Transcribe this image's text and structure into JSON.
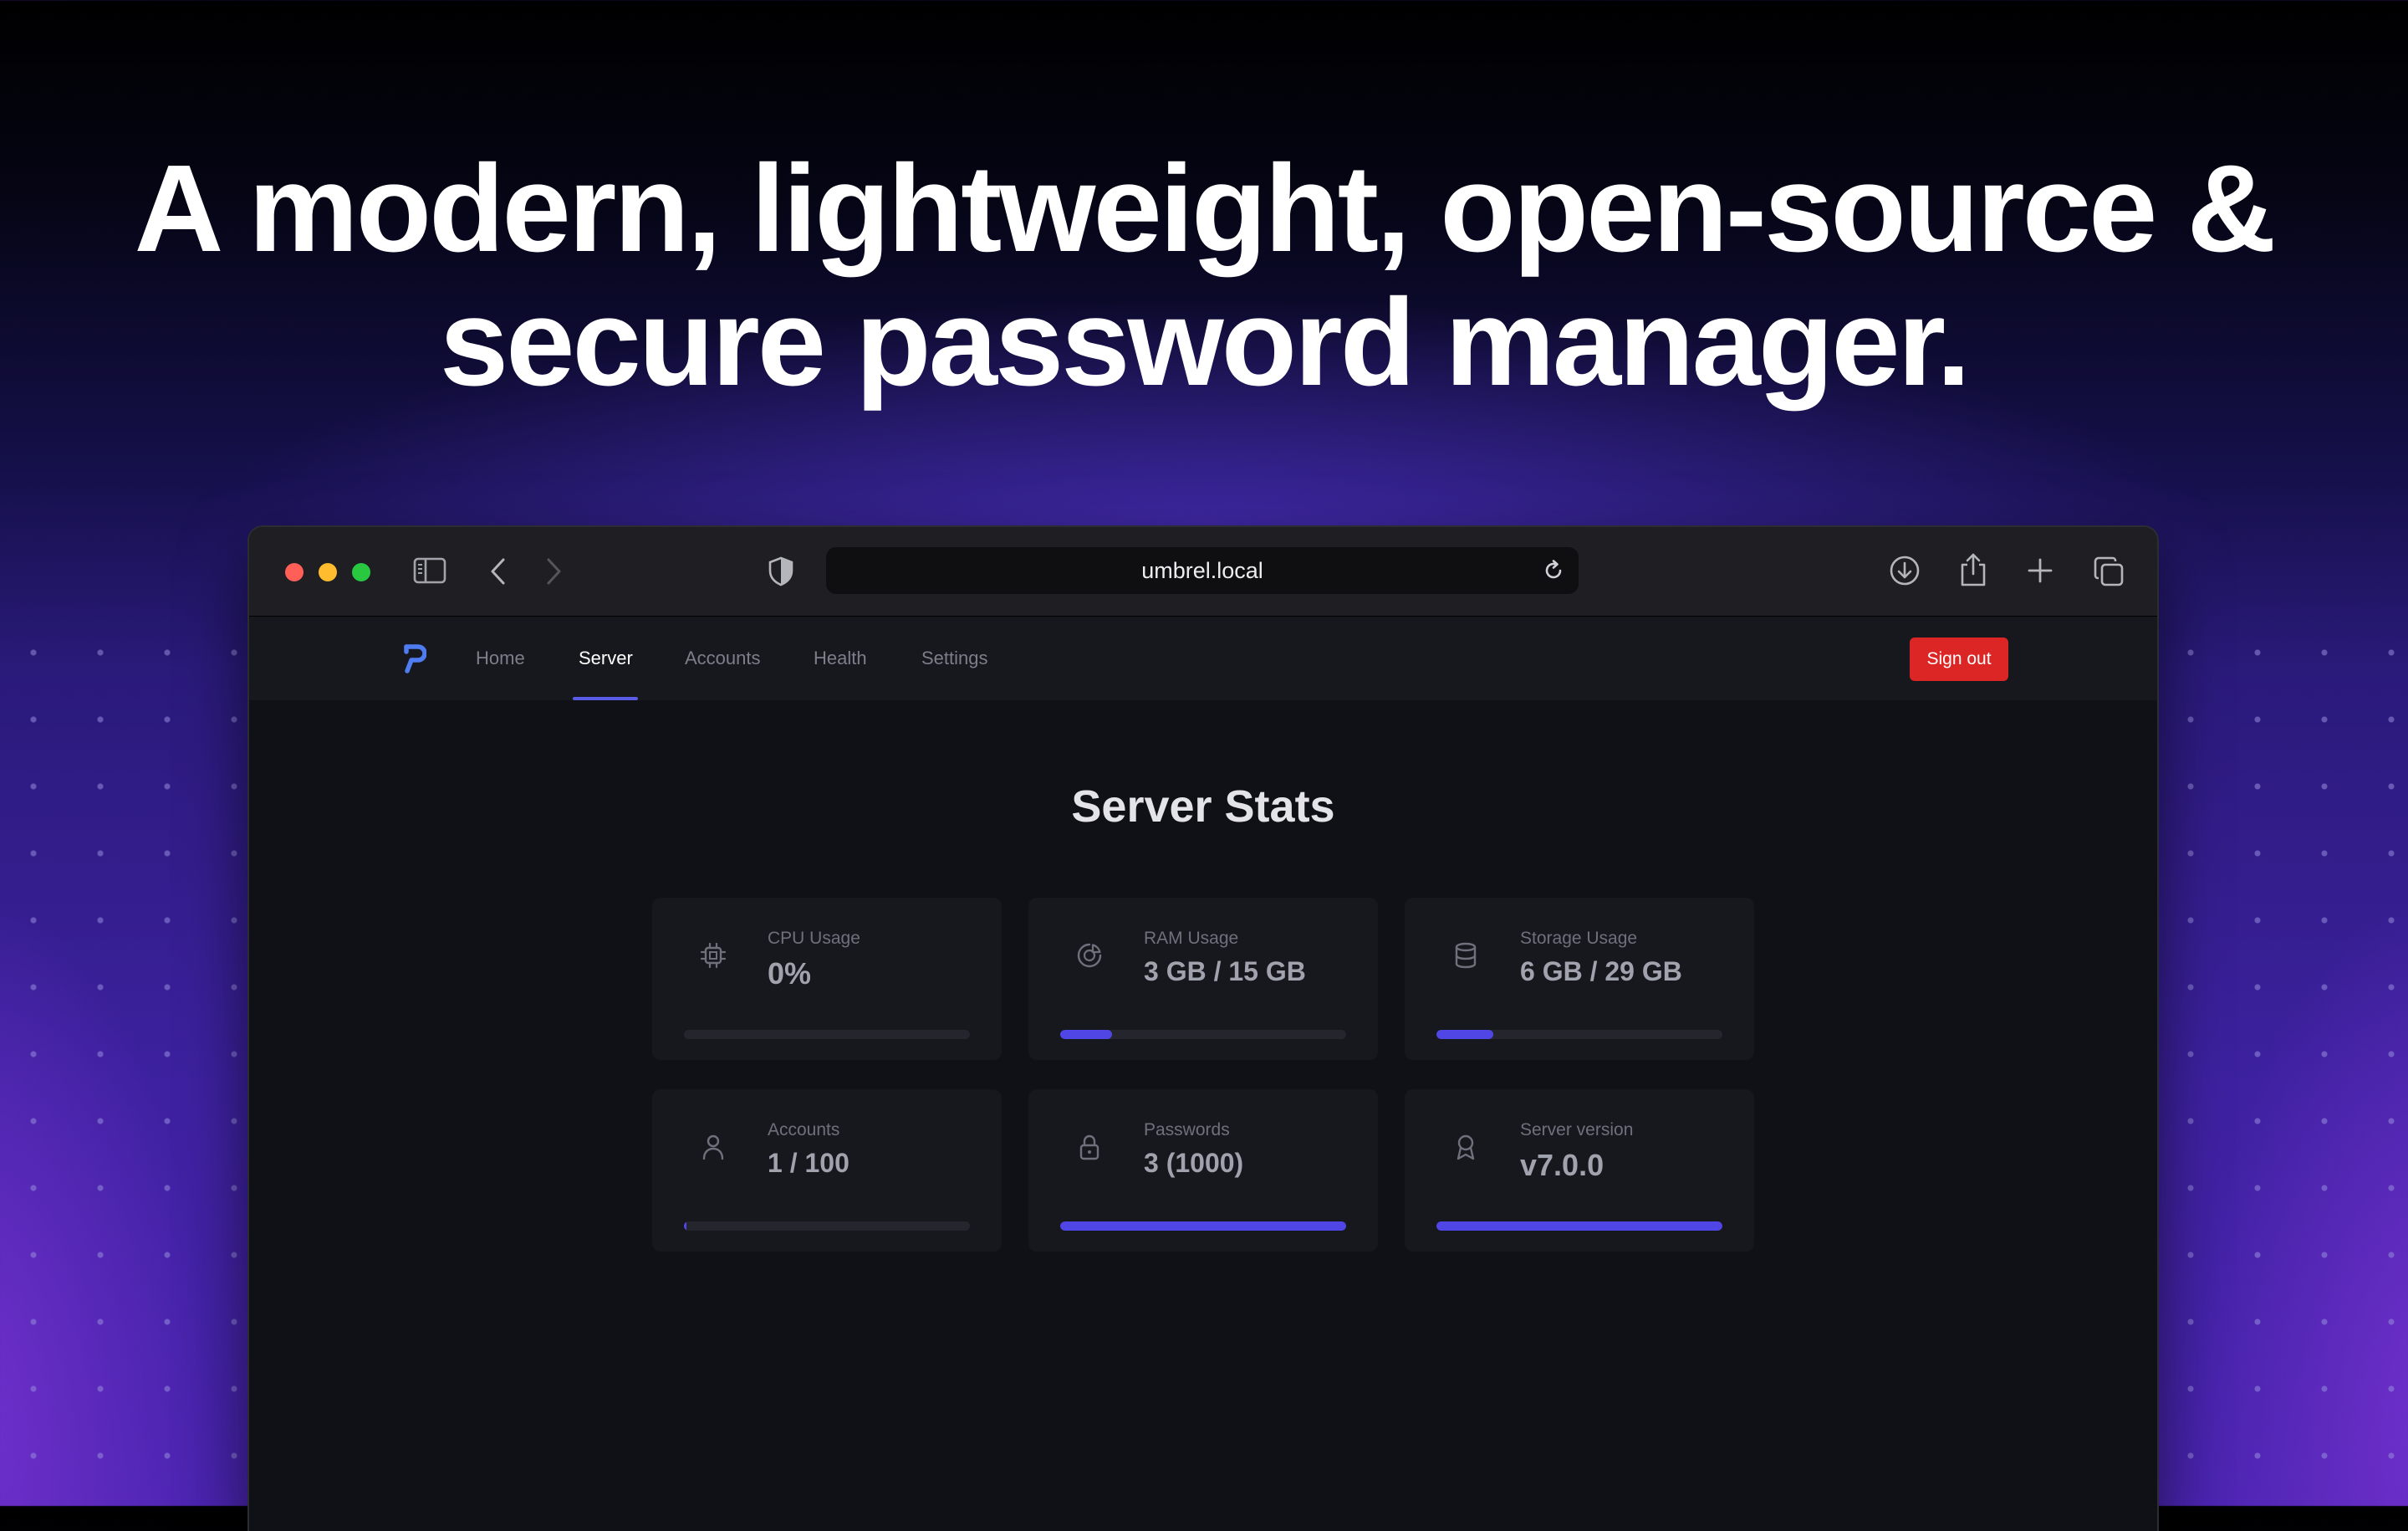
{
  "headline": {
    "line1": "A modern, lightweight, open-source &",
    "line2": "secure password manager."
  },
  "browser": {
    "url": "umbrel.local",
    "traffic_lights": [
      "#ff5f57",
      "#febc2e",
      "#28c840"
    ]
  },
  "app": {
    "nav": {
      "items": [
        {
          "label": "Home",
          "active": false
        },
        {
          "label": "Server",
          "active": true
        },
        {
          "label": "Accounts",
          "active": false
        },
        {
          "label": "Health",
          "active": false
        },
        {
          "label": "Settings",
          "active": false
        }
      ],
      "sign_out_label": "Sign out"
    },
    "page_title": "Server Stats",
    "accent_color": "#4f46e5",
    "stats": [
      {
        "label": "CPU Usage",
        "value": "0%",
        "icon": "cpu-icon",
        "progress": 0.0
      },
      {
        "label": "RAM Usage",
        "value": "3 GB / 15 GB",
        "icon": "pie-chart-icon",
        "progress": 0.18
      },
      {
        "label": "Storage Usage",
        "value": "6 GB / 29 GB",
        "icon": "database-icon",
        "progress": 0.2
      },
      {
        "label": "Accounts",
        "value": "1 / 100",
        "icon": "user-icon",
        "progress": 0.01
      },
      {
        "label": "Passwords",
        "value": "3 (1000)",
        "icon": "lock-icon",
        "progress": 1.0
      },
      {
        "label": "Server version",
        "value": "v7.0.0",
        "icon": "award-icon",
        "progress": 1.0
      }
    ]
  }
}
